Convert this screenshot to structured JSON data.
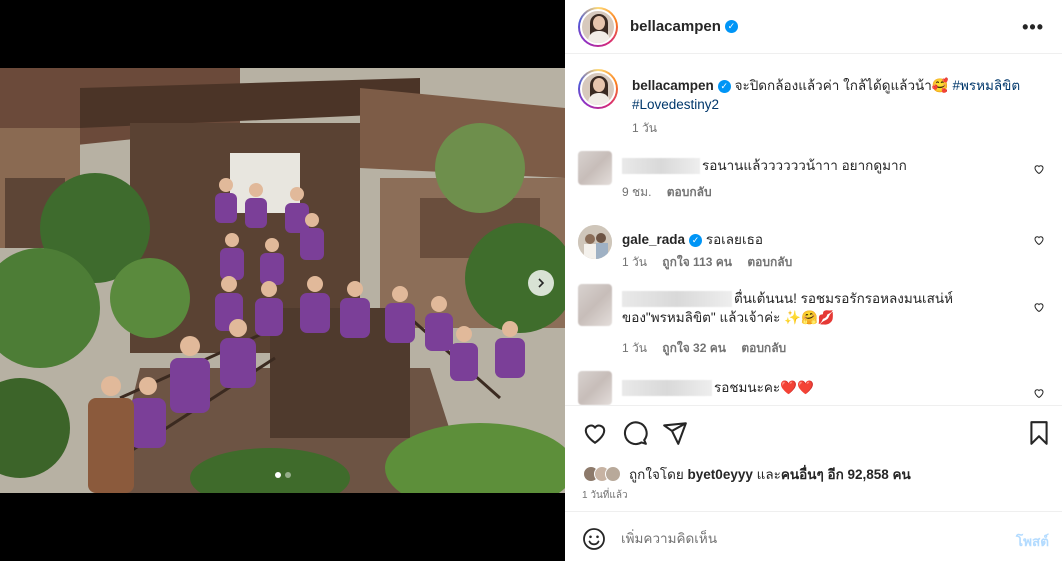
{
  "post": {
    "username": "bellacampen",
    "more_icon": "more-horizontal-icon"
  },
  "caption": {
    "username": "bellacampen",
    "text": "จะปิดกล้องแล้วค่า ใกล้ได้ดูแล้วน้า🥰",
    "hashtag1": "#พรหมลิขิต",
    "hashtag2": "#Lovedestiny2",
    "time": "1 วัน"
  },
  "comments": [
    {
      "text": "รอนานแล้ววววววน้าาา อยากดูมาก",
      "time": "9 ชม.",
      "likes": "",
      "reply": "ตอบกลับ"
    },
    {
      "username": "gale_rada",
      "text": "รอเลยเธอ",
      "time": "1 วัน",
      "likes": "ถูกใจ 113 คน",
      "reply": "ตอบกลับ"
    },
    {
      "text_line1": "ตื่นเต้นนน! รอชมรอรักรอหลงมนเสน่ห์",
      "text_line2": "ของ\"พรหมลิขิต\" แล้วเจ้าค่ะ ✨🤗💋",
      "time": "1 วัน",
      "likes": "ถูกใจ 32 คน",
      "reply": "ตอบกลับ"
    },
    {
      "text": "รอชมนะคะ❤️❤️"
    }
  ],
  "actions": {
    "liked_prefix": "ถูกใจโดย",
    "liked_user": "byet0eyyy",
    "liked_middle": "และ",
    "liked_others": "คนอื่นๆ อีก 92,858 คน",
    "date": "1 วันที่แล้ว"
  },
  "composer": {
    "placeholder": "เพิ่มความคิดเห็น",
    "post_label": "โพสต์"
  },
  "carousel": {
    "current": 1,
    "total": 2
  },
  "colors": {
    "verified": "#0095f6",
    "hashtag": "#00376b",
    "post_disabled": "#b3dbff",
    "shirt": "#7b3f98"
  }
}
